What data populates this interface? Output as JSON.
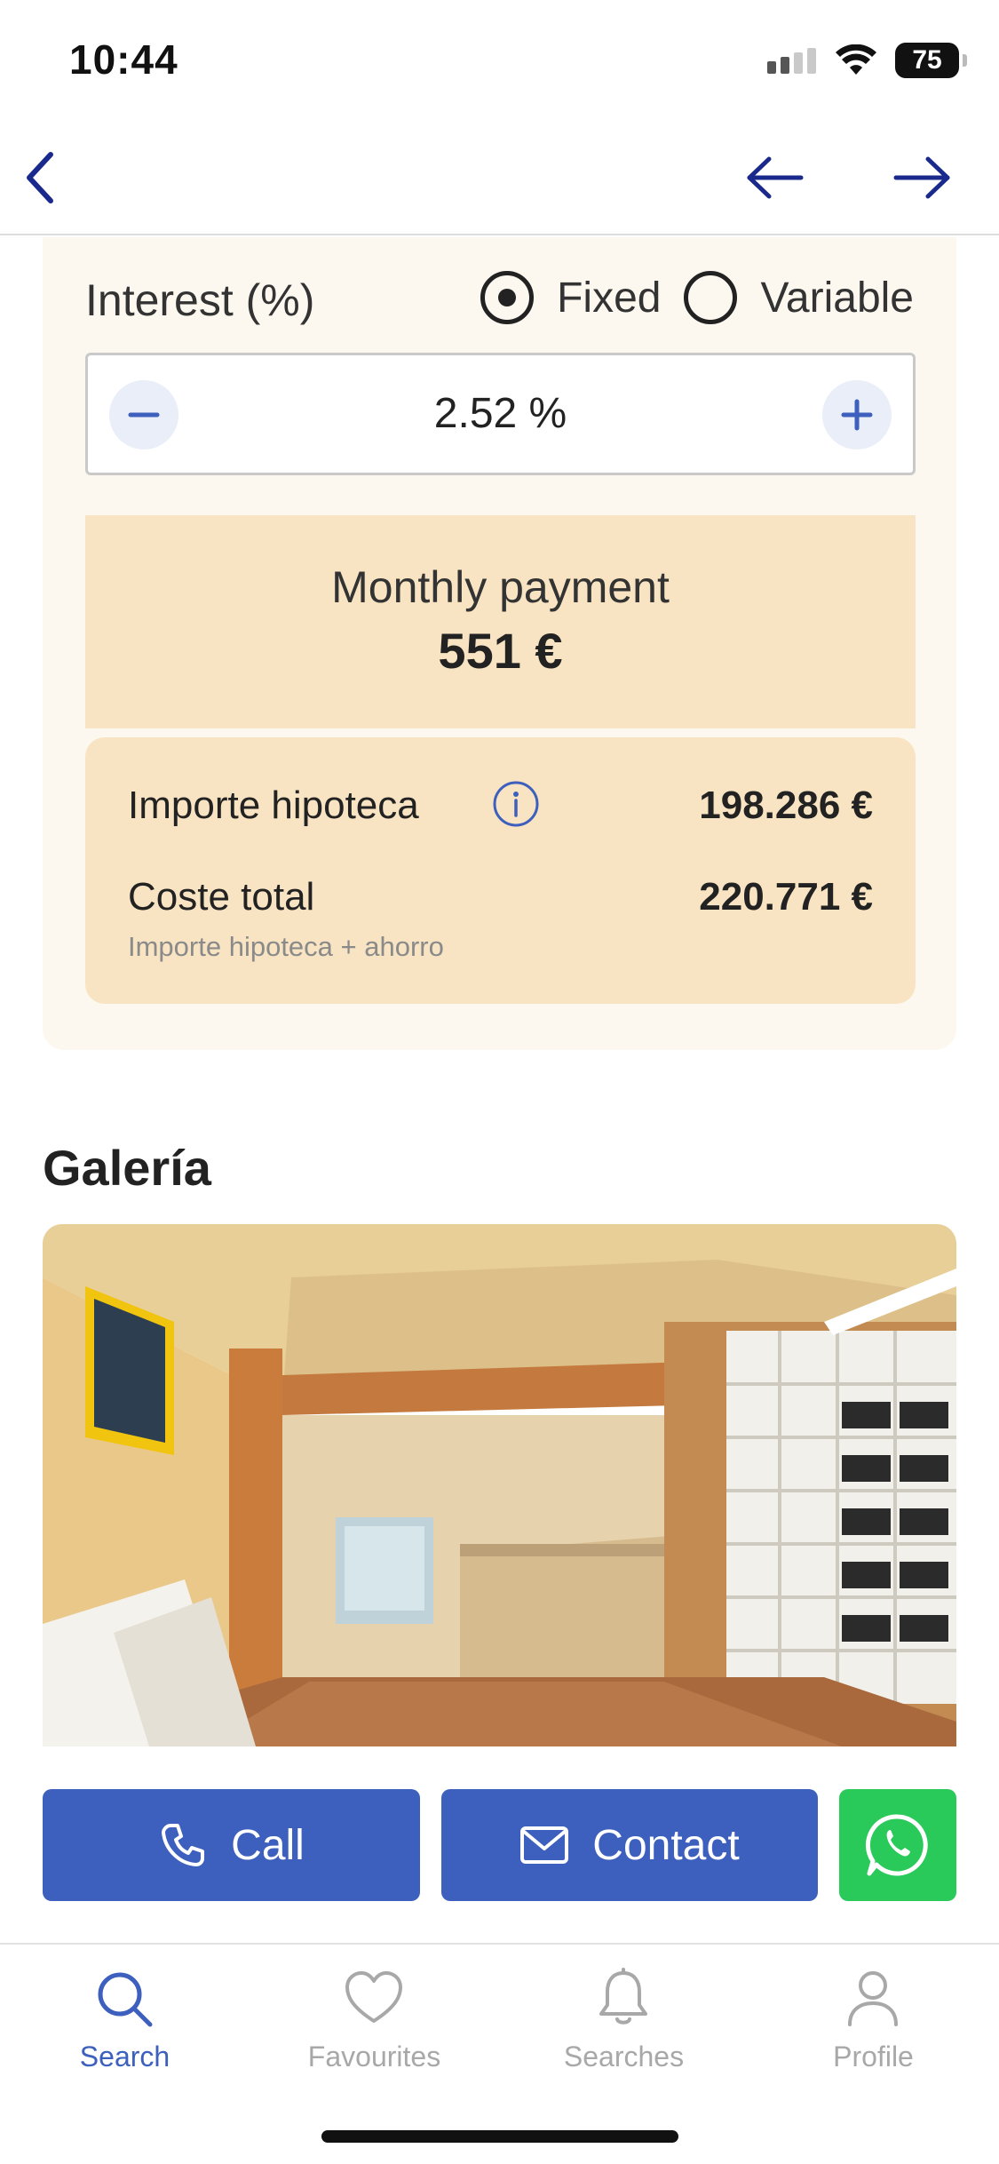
{
  "status_bar": {
    "time": "10:44",
    "battery": "75"
  },
  "mortgage": {
    "interest_label": "Interest (%)",
    "rate_type_options": [
      "Fixed",
      "Variable"
    ],
    "rate_type_selected": "Fixed",
    "interest_value": "2.52 %",
    "monthly_payment_label": "Monthly payment",
    "monthly_payment_value": "551 €",
    "mortgage_amount_label": "Importe hipoteca",
    "mortgage_amount_value": "198.286 €",
    "total_cost_label": "Coste total",
    "total_cost_value": "220.771 €",
    "total_cost_note": "Importe hipoteca + ahorro"
  },
  "gallery": {
    "title": "Galería"
  },
  "actions": {
    "call_label": "Call",
    "contact_label": "Contact"
  },
  "tab_bar": {
    "tabs": [
      {
        "label": "Search",
        "icon": "search-icon",
        "active": true
      },
      {
        "label": "Favourites",
        "icon": "heart-icon",
        "active": false
      },
      {
        "label": "Searches",
        "icon": "bell-icon",
        "active": false
      },
      {
        "label": "Profile",
        "icon": "user-icon",
        "active": false
      }
    ]
  },
  "colors": {
    "accent": "#3d5fbd",
    "whatsapp": "#29c95a",
    "card_bg": "#fdf8ef",
    "highlight_bg": "#f8e4c2",
    "nav": "#1a2a8c"
  }
}
